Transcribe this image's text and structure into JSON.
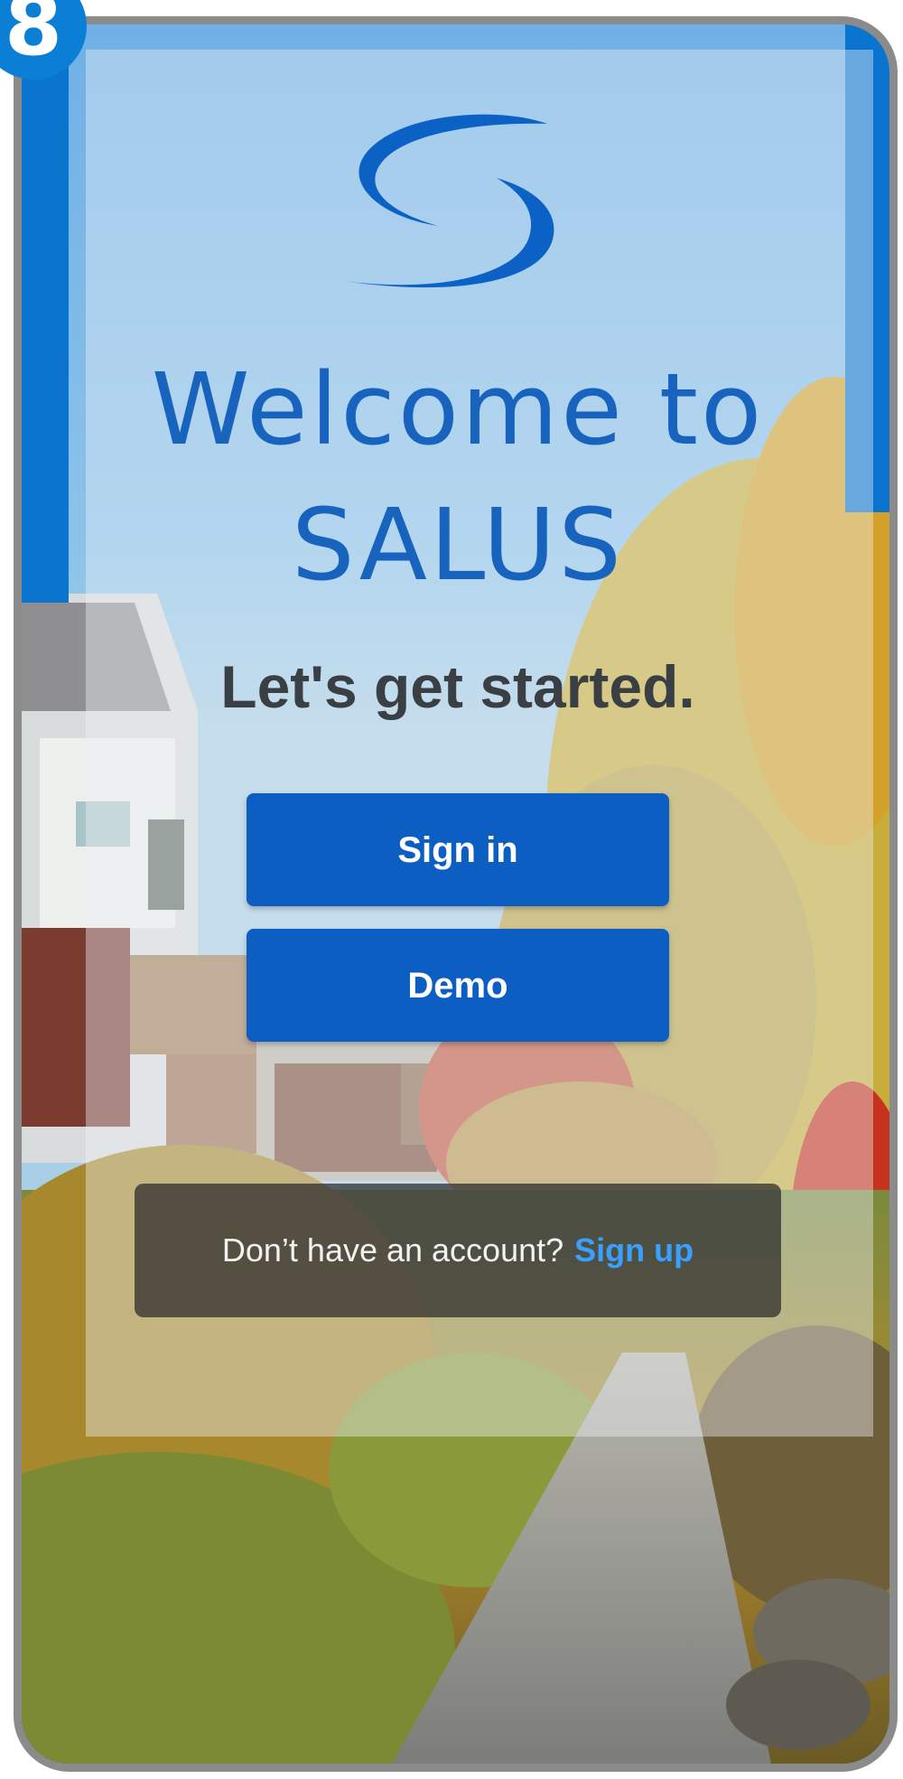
{
  "step_badge": "8",
  "welcome": {
    "line1": "Welcome to",
    "line2": "SALUS"
  },
  "tagline": "Let's get started.",
  "buttons": {
    "sign_in": "Sign in",
    "demo": "Demo"
  },
  "account": {
    "question": "Don’t have an account?",
    "signup_link": "Sign up"
  },
  "colors": {
    "primary_blue": "#0c5ec2",
    "title_blue": "#1763bd",
    "link_blue": "#3aa0ff",
    "badge_blue": "#0b7fd6",
    "frame_gray": "#8b8b8b"
  },
  "icons": {
    "logo": "salus-swirl-logo",
    "background": "neighborhood-path-photo"
  }
}
